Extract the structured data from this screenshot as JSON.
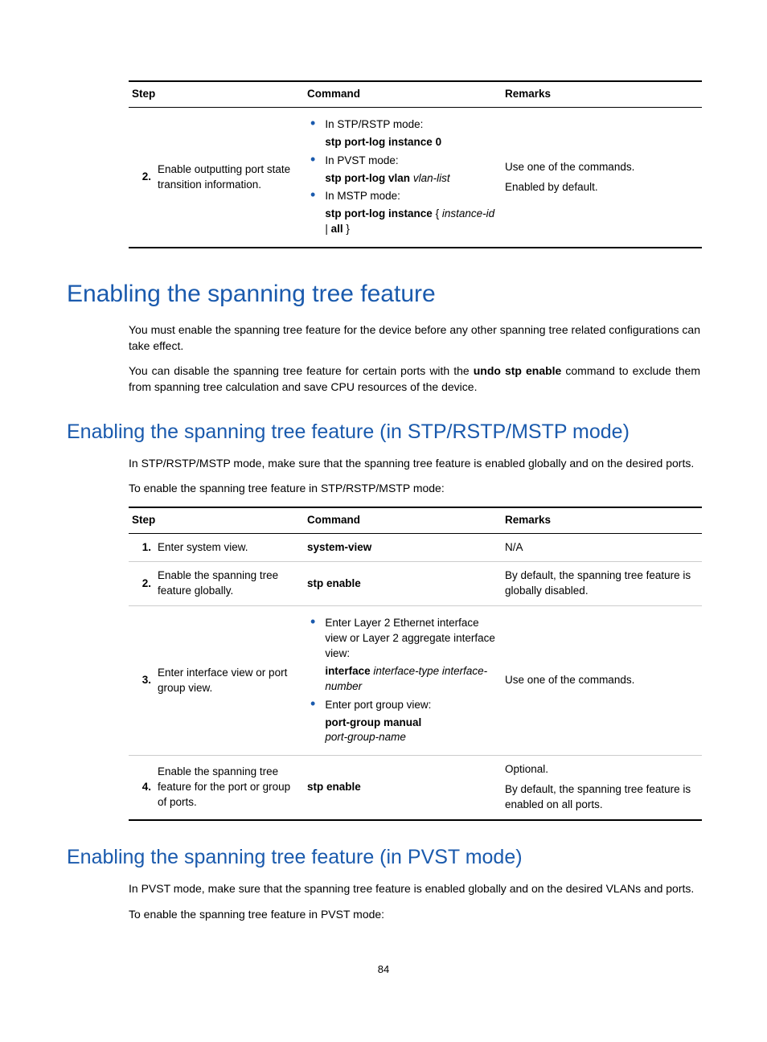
{
  "page_number": "84",
  "table1": {
    "headers": {
      "step": "Step",
      "command": "Command",
      "remarks": "Remarks"
    },
    "row": {
      "num": "2.",
      "step_text": "Enable outputting port state transition information.",
      "bullets": [
        {
          "intro": "In STP/RSTP mode:",
          "cmd_bold": "stp port-log instance 0",
          "cmd_italic": ""
        },
        {
          "intro": "In PVST mode:",
          "cmd_bold": "stp port-log vlan",
          "cmd_italic": "vlan-list"
        },
        {
          "intro": "In MSTP mode:",
          "cmd_bold_a": "stp port-log instance",
          "brace_open": "{",
          "cmd_italic": "instance-id",
          "pipe": "|",
          "cmd_bold_b": "all",
          "brace_close": "}"
        }
      ],
      "remarks_l1": "Use one of the commands.",
      "remarks_l2": "Enabled by default."
    }
  },
  "h1": "Enabling the spanning tree feature",
  "p1_a": "You must enable the spanning tree feature for the device before any other spanning tree related configurations can take effect.",
  "p1_b_pre": "You can disable the spanning tree feature for certain ports with the ",
  "p1_b_bold": "undo stp enable",
  "p1_b_post": " command to exclude them from spanning tree calculation and save CPU resources of the device.",
  "h2a": "Enabling the spanning tree feature (in STP/RSTP/MSTP mode)",
  "p2a": "In STP/RSTP/MSTP mode, make sure that the spanning tree feature is enabled globally and on the desired ports.",
  "p2b": "To enable the spanning tree feature in STP/RSTP/MSTP mode:",
  "table2": {
    "headers": {
      "step": "Step",
      "command": "Command",
      "remarks": "Remarks"
    },
    "rows": [
      {
        "num": "1.",
        "step": "Enter system view.",
        "cmd_bold": "system-view",
        "remarks": "N/A"
      },
      {
        "num": "2.",
        "step": "Enable the spanning tree feature globally.",
        "cmd_bold": "stp enable",
        "remarks": "By default, the spanning tree feature is globally disabled."
      },
      {
        "num": "3.",
        "step": "Enter interface view or port group view.",
        "bullets": [
          {
            "intro": "Enter Layer 2 Ethernet interface view or Layer 2 aggregate interface view:",
            "cmd_bold": "interface",
            "cmd_italic": "interface-type interface-number"
          },
          {
            "intro": "Enter port group view:",
            "cmd_bold": "port-group manual",
            "cmd_italic": "port-group-name"
          }
        ],
        "remarks": "Use one of the commands."
      },
      {
        "num": "4.",
        "step": "Enable the spanning tree feature for the port or group of ports.",
        "cmd_bold": "stp enable",
        "remarks_l1": "Optional.",
        "remarks_l2": "By default, the spanning tree feature is enabled on all ports."
      }
    ]
  },
  "h2b": "Enabling the spanning tree feature (in PVST mode)",
  "p3a": "In PVST mode, make sure that the spanning tree feature is enabled globally and on the desired VLANs and ports.",
  "p3b": "To enable the spanning tree feature in PVST mode:"
}
